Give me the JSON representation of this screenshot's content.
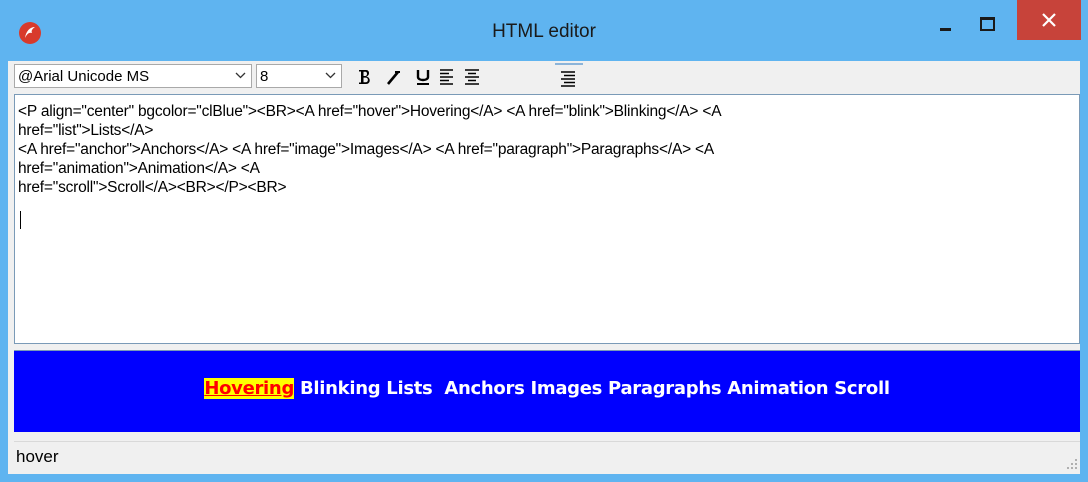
{
  "window": {
    "title": "HTML editor",
    "icon": "app-flame-icon",
    "title_bar_color": "#5fb4f0",
    "close_color": "#c7433a"
  },
  "toolbar": {
    "font_name": "@Arial Unicode MS",
    "font_size": "8",
    "buttons": [
      {
        "name": "bold",
        "icon": "bold-icon"
      },
      {
        "name": "italic",
        "icon": "italic-icon"
      },
      {
        "name": "underline",
        "icon": "underline-icon"
      },
      {
        "name": "align-left",
        "icon": "align-left-icon"
      },
      {
        "name": "align-center",
        "icon": "align-center-icon"
      },
      {
        "name": "align-right",
        "icon": "align-right-icon"
      }
    ]
  },
  "editor": {
    "source_text": "<P align=\"center\" bgcolor=\"clBlue\"><BR><A href=\"hover\">Hovering</A> <A href=\"blink\">Blinking</A> <A\nhref=\"list\">Lists</A>\n<A href=\"anchor\">Anchors</A> <A href=\"image\">Images</A> <A href=\"paragraph\">Paragraphs</A> <A\nhref=\"animation\">Animation</A> <A\nhref=\"scroll\">Scroll</A><BR></P><BR>"
  },
  "preview": {
    "background": "#0000ff",
    "link_color": "#ffffff",
    "hover_bg": "#ffff00",
    "hover_fg": "#ff0000",
    "links": [
      "Hovering",
      "Blinking",
      "Lists ",
      "Anchors",
      "Images",
      "Paragraphs",
      "Animation",
      "Scroll"
    ]
  },
  "statusbar": {
    "text": "hover"
  }
}
